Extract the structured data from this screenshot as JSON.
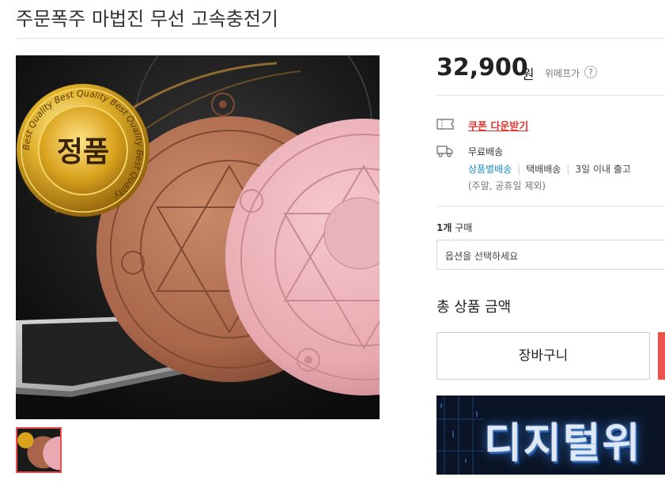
{
  "product": {
    "title": "주문폭주 마법진 무선 고속충전기",
    "badge_text": "정품",
    "badge_ring_text": "Best Quality Best Quality Best Quality Best Quality"
  },
  "price": {
    "amount": "32,900",
    "unit": "원",
    "label": "위메프가",
    "help": "?"
  },
  "coupon": {
    "label": "쿠폰 다운받기"
  },
  "shipping": {
    "free_label": "무료배송",
    "option1": "상품별배송",
    "option2": "택배배송",
    "option3": "3일 이내 출고",
    "note": "(주말, 공휴일 제외)"
  },
  "purchase": {
    "qty_count": "1개",
    "qty_suffix": "구매",
    "option_placeholder": "옵션을 선택하세요",
    "total_label": "총 상품 금액",
    "cart_label": "장바구니"
  },
  "banner": {
    "text": "디지털위"
  },
  "colors": {
    "accent_red": "#e3342f",
    "link_blue": "#1a8fc9",
    "buy_red": "#e9524a"
  }
}
